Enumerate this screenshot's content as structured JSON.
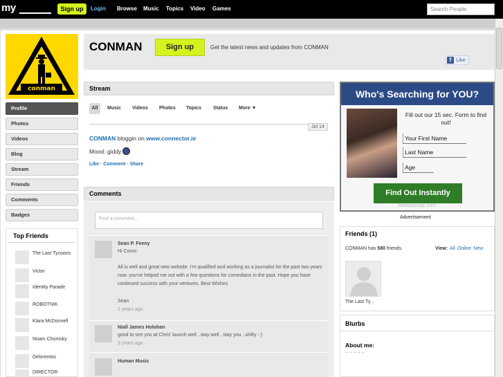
{
  "topbar": {
    "logo": "my",
    "signup": "Sign up",
    "login": "Login",
    "nav": [
      "Browse",
      "Music",
      "Topics",
      "Video",
      "Games"
    ],
    "search_placeholder": "Search People"
  },
  "profile": {
    "name": "CONMAN",
    "logo_text": "conman",
    "signup": "Sign up",
    "tagline": "Get the latest news and updates from CONMAN",
    "like": "Like"
  },
  "sidebar": {
    "items": [
      "Profile",
      "Photos",
      "Videos",
      "Blog",
      "Stream",
      "Friends",
      "Comments",
      "Badges"
    ],
    "active": "Profile"
  },
  "top_friends": {
    "title": "Top Friends",
    "names": [
      "The Last Tycoons",
      "Victor",
      "Identity Parade",
      "ROBOTNIK",
      "Klara McDonnell",
      "Noam Chomsky",
      "Delorentos",
      "DIRECTOR"
    ]
  },
  "stream": {
    "title": "Stream",
    "tabs": [
      "All",
      "Music",
      "Videos",
      "Photos",
      "Topics",
      "Status",
      "More ▼"
    ],
    "date": "Jul 14",
    "post_author": "CONMAN",
    "post_verb": "bloggin on",
    "post_link": "www.connector.ie",
    "mood_label": "Mood: giddy",
    "actions": "Like · Comment · Share"
  },
  "comments": {
    "title": "Comments",
    "placeholder": "Post a comment...",
    "items": [
      {
        "name": "Sean P. Feeny",
        "greeting": "Hi Conor.",
        "body": "All is well and great new website. I'm qualified and working as a journalist for the past two years now. you've helped me out with a few questions for comedians in the past. Hope you have continued success with your ventures. Best Wishes",
        "sign": "Sean",
        "time": "2 years ago"
      },
      {
        "name": "Niall James Holohan",
        "body": "good to see you at Chris' launch well ..stay well ..stay you ..shifty :-)",
        "time": "3 years ago"
      },
      {
        "name": "Human Music"
      }
    ]
  },
  "ad": {
    "title": "Who's Searching for YOU?",
    "text": "Fill out our 15 sec. Form to find out!",
    "fields": [
      "Your First Name",
      "Last Name",
      "Age"
    ],
    "button": "Find Out Instantly",
    "url": "webappyapp.com",
    "label": "Advertisement"
  },
  "friends": {
    "title": "Friends (1)",
    "count_prefix": "CONMAN has",
    "count": "580",
    "count_suffix": "friends.",
    "view_label": "View:",
    "view_links": [
      "All",
      "Online",
      "New"
    ],
    "thumb_name": "The Last Ty..."
  },
  "blurbs": {
    "title": "Blurbs",
    "about_label": "About me:",
    "about_value": ".. .. .. .. .."
  },
  "colors": {
    "accent_yellow": "#d6f21e",
    "link_blue": "#1a6fb3",
    "ad_blue": "#2c4b86",
    "ad_green": "#2f7d28"
  }
}
